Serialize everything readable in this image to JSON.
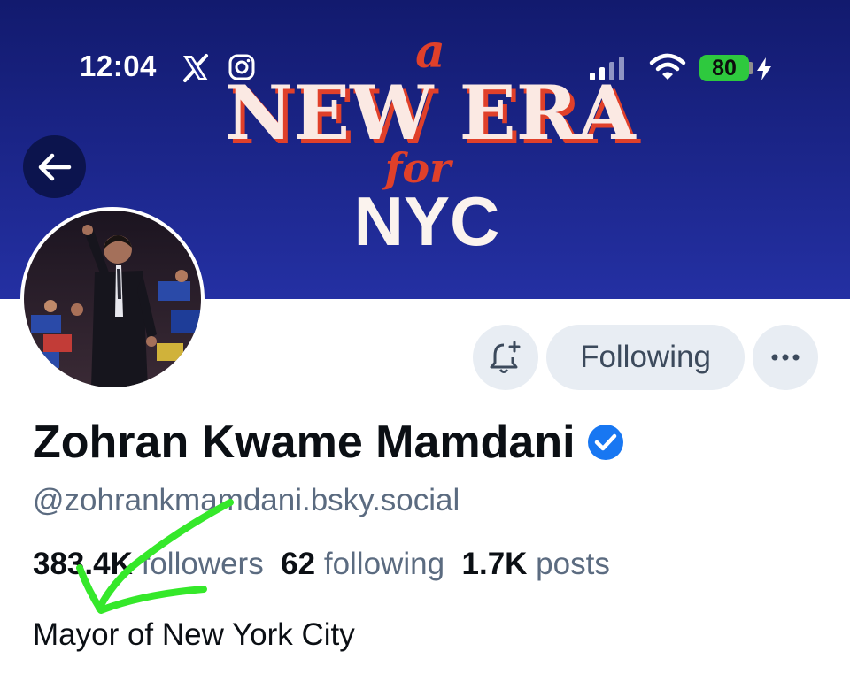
{
  "status_bar": {
    "time": "12:04",
    "battery": "80",
    "icons": [
      "x-logo-icon",
      "instagram-icon",
      "signal-icon",
      "wifi-icon",
      "battery-icon",
      "charging-bolt-icon"
    ]
  },
  "banner": {
    "line_a": "a",
    "line_main": "NEW ERA",
    "line_for": "for",
    "line_city": "NYC",
    "colors": {
      "background": "#1c2690",
      "text": "#fbe9e3",
      "accent": "#e0402a"
    }
  },
  "header": {
    "back_icon": "arrow-left-icon"
  },
  "actions": {
    "notify_icon": "bell-plus-icon",
    "following_label": "Following",
    "more_icon": "ellipsis-icon"
  },
  "profile": {
    "display_name": "Zohran Kwame Mamdani",
    "verified_icon": "verified-check-icon",
    "handle": "@zohrankmamdani.bsky.social",
    "stats": {
      "followers_count": "383.4K",
      "followers_label": "followers",
      "following_count": "62",
      "following_label": "following",
      "posts_count": "1.7K",
      "posts_label": "posts"
    },
    "bio": "Mayor of New York City"
  },
  "annotation": {
    "color": "#35e82a",
    "icon": "hand-drawn-arrow"
  }
}
